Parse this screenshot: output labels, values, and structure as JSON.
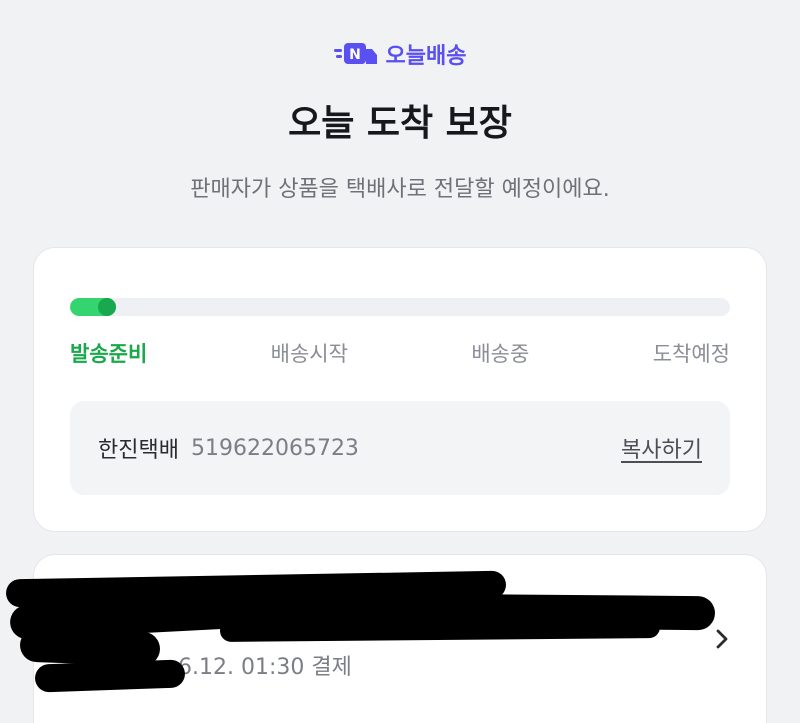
{
  "brand": {
    "logo_letter": "N",
    "name": "오늘배송",
    "color": "#5a4ff0"
  },
  "header": {
    "title": "오늘 도착 보장",
    "subtitle": "판매자가 상품을 택배사로 전달할 예정이에요."
  },
  "tracking": {
    "progress_fraction": 0.07,
    "active_color": "#1aa84c",
    "steps": [
      {
        "label": "발송준비",
        "active": true
      },
      {
        "label": "배송시작",
        "active": false
      },
      {
        "label": "배송중",
        "active": false
      },
      {
        "label": "도착예정",
        "active": false
      }
    ],
    "carrier": "한진택배",
    "invoice_number": "519622065723",
    "copy_label": "복사하기"
  },
  "order": {
    "payment_time": "6.12. 01:30 결제",
    "chevron_icon": "chevron-right-icon"
  }
}
